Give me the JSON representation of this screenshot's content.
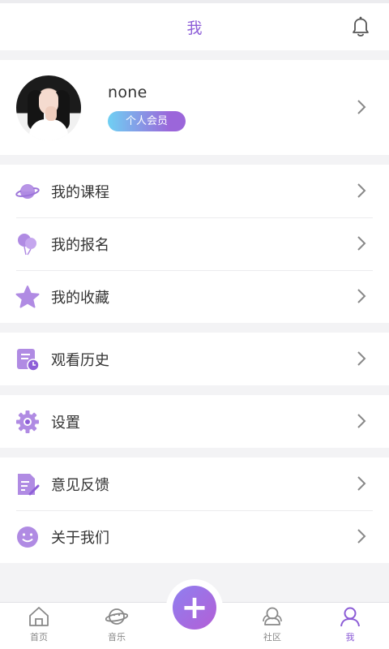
{
  "header": {
    "title": "我",
    "bell_icon": "bell-icon"
  },
  "profile": {
    "username": "none",
    "badge": "个人会员"
  },
  "menu_groups": [
    {
      "items": [
        {
          "label": "我的课程",
          "icon": "planet-icon"
        },
        {
          "label": "我的报名",
          "icon": "balloons-icon"
        },
        {
          "label": "我的收藏",
          "icon": "star-icon"
        }
      ]
    },
    {
      "items": [
        {
          "label": "观看历史",
          "icon": "history-icon"
        }
      ]
    },
    {
      "items": [
        {
          "label": "设置",
          "icon": "gear-icon"
        }
      ]
    },
    {
      "items": [
        {
          "label": "意见反馈",
          "icon": "feedback-icon"
        },
        {
          "label": "关于我们",
          "icon": "smiley-icon"
        }
      ]
    }
  ],
  "tabbar": {
    "tabs": [
      {
        "label": "首页",
        "icon": "home-icon"
      },
      {
        "label": "音乐",
        "icon": "music-planet-icon"
      },
      {
        "label": "",
        "icon": "plus-icon"
      },
      {
        "label": "社区",
        "icon": "community-icon"
      },
      {
        "label": "我",
        "icon": "profile-icon"
      }
    ],
    "fab_symbol": "+"
  },
  "colors": {
    "accent": "#8e5fd8",
    "icon_purple": "#b08be3",
    "background": "#f3f3f5"
  }
}
